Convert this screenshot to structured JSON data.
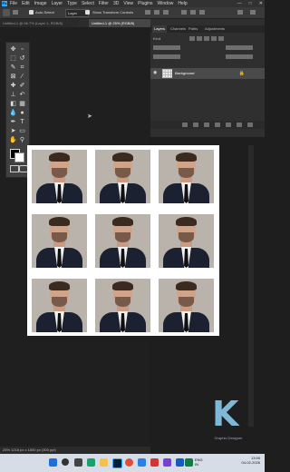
{
  "app": {
    "logo": "Ps",
    "menu": [
      "File",
      "Edit",
      "Image",
      "Layer",
      "Type",
      "Select",
      "Filter",
      "3D",
      "View",
      "Plugins",
      "Window",
      "Help"
    ],
    "window_controls": [
      "—",
      "□",
      "✕"
    ]
  },
  "options_bar": {
    "auto_select_label": "Auto-Select",
    "auto_select_target": "Layer",
    "show_transform_label": "Show Transform Controls"
  },
  "doc_tabs": [
    {
      "label": "Untitled-1 @ 66.7% (Layer 1, RGB/8)"
    },
    {
      "label": "Untitled-1 @ 25% (RGB/8)"
    }
  ],
  "panels": {
    "tabs": [
      "Layers",
      "Channels",
      "Paths",
      "Adjustments"
    ],
    "active_tab": "Layers",
    "filter_label": "Kind",
    "layer": {
      "name": "Background",
      "lock_icon": "lock-icon"
    }
  },
  "canvas": {
    "sheet": {
      "rows": 3,
      "cols": 3
    }
  },
  "status_bar": {
    "text": "25%        1218 px x 1800 px (300 ppi)"
  },
  "watermark": {
    "letter": "K",
    "caption": "Graphic Designer"
  },
  "taskbar": {
    "lang": "ENG\nIN",
    "time": "13:55",
    "date": "04-02-2026",
    "icons": [
      "start-icon",
      "search-icon",
      "task-view-icon",
      "edge-icon",
      "folder-icon",
      "photoshop-icon",
      "chrome-icon",
      "store-icon",
      "mail-icon",
      "media-icon",
      "word-icon",
      "excel-icon"
    ]
  },
  "colors": {
    "accent": "#31a8ff",
    "workspace": "#1f1f1f",
    "panel": "#2f2f2f",
    "taskbar": "#d6dde6"
  }
}
